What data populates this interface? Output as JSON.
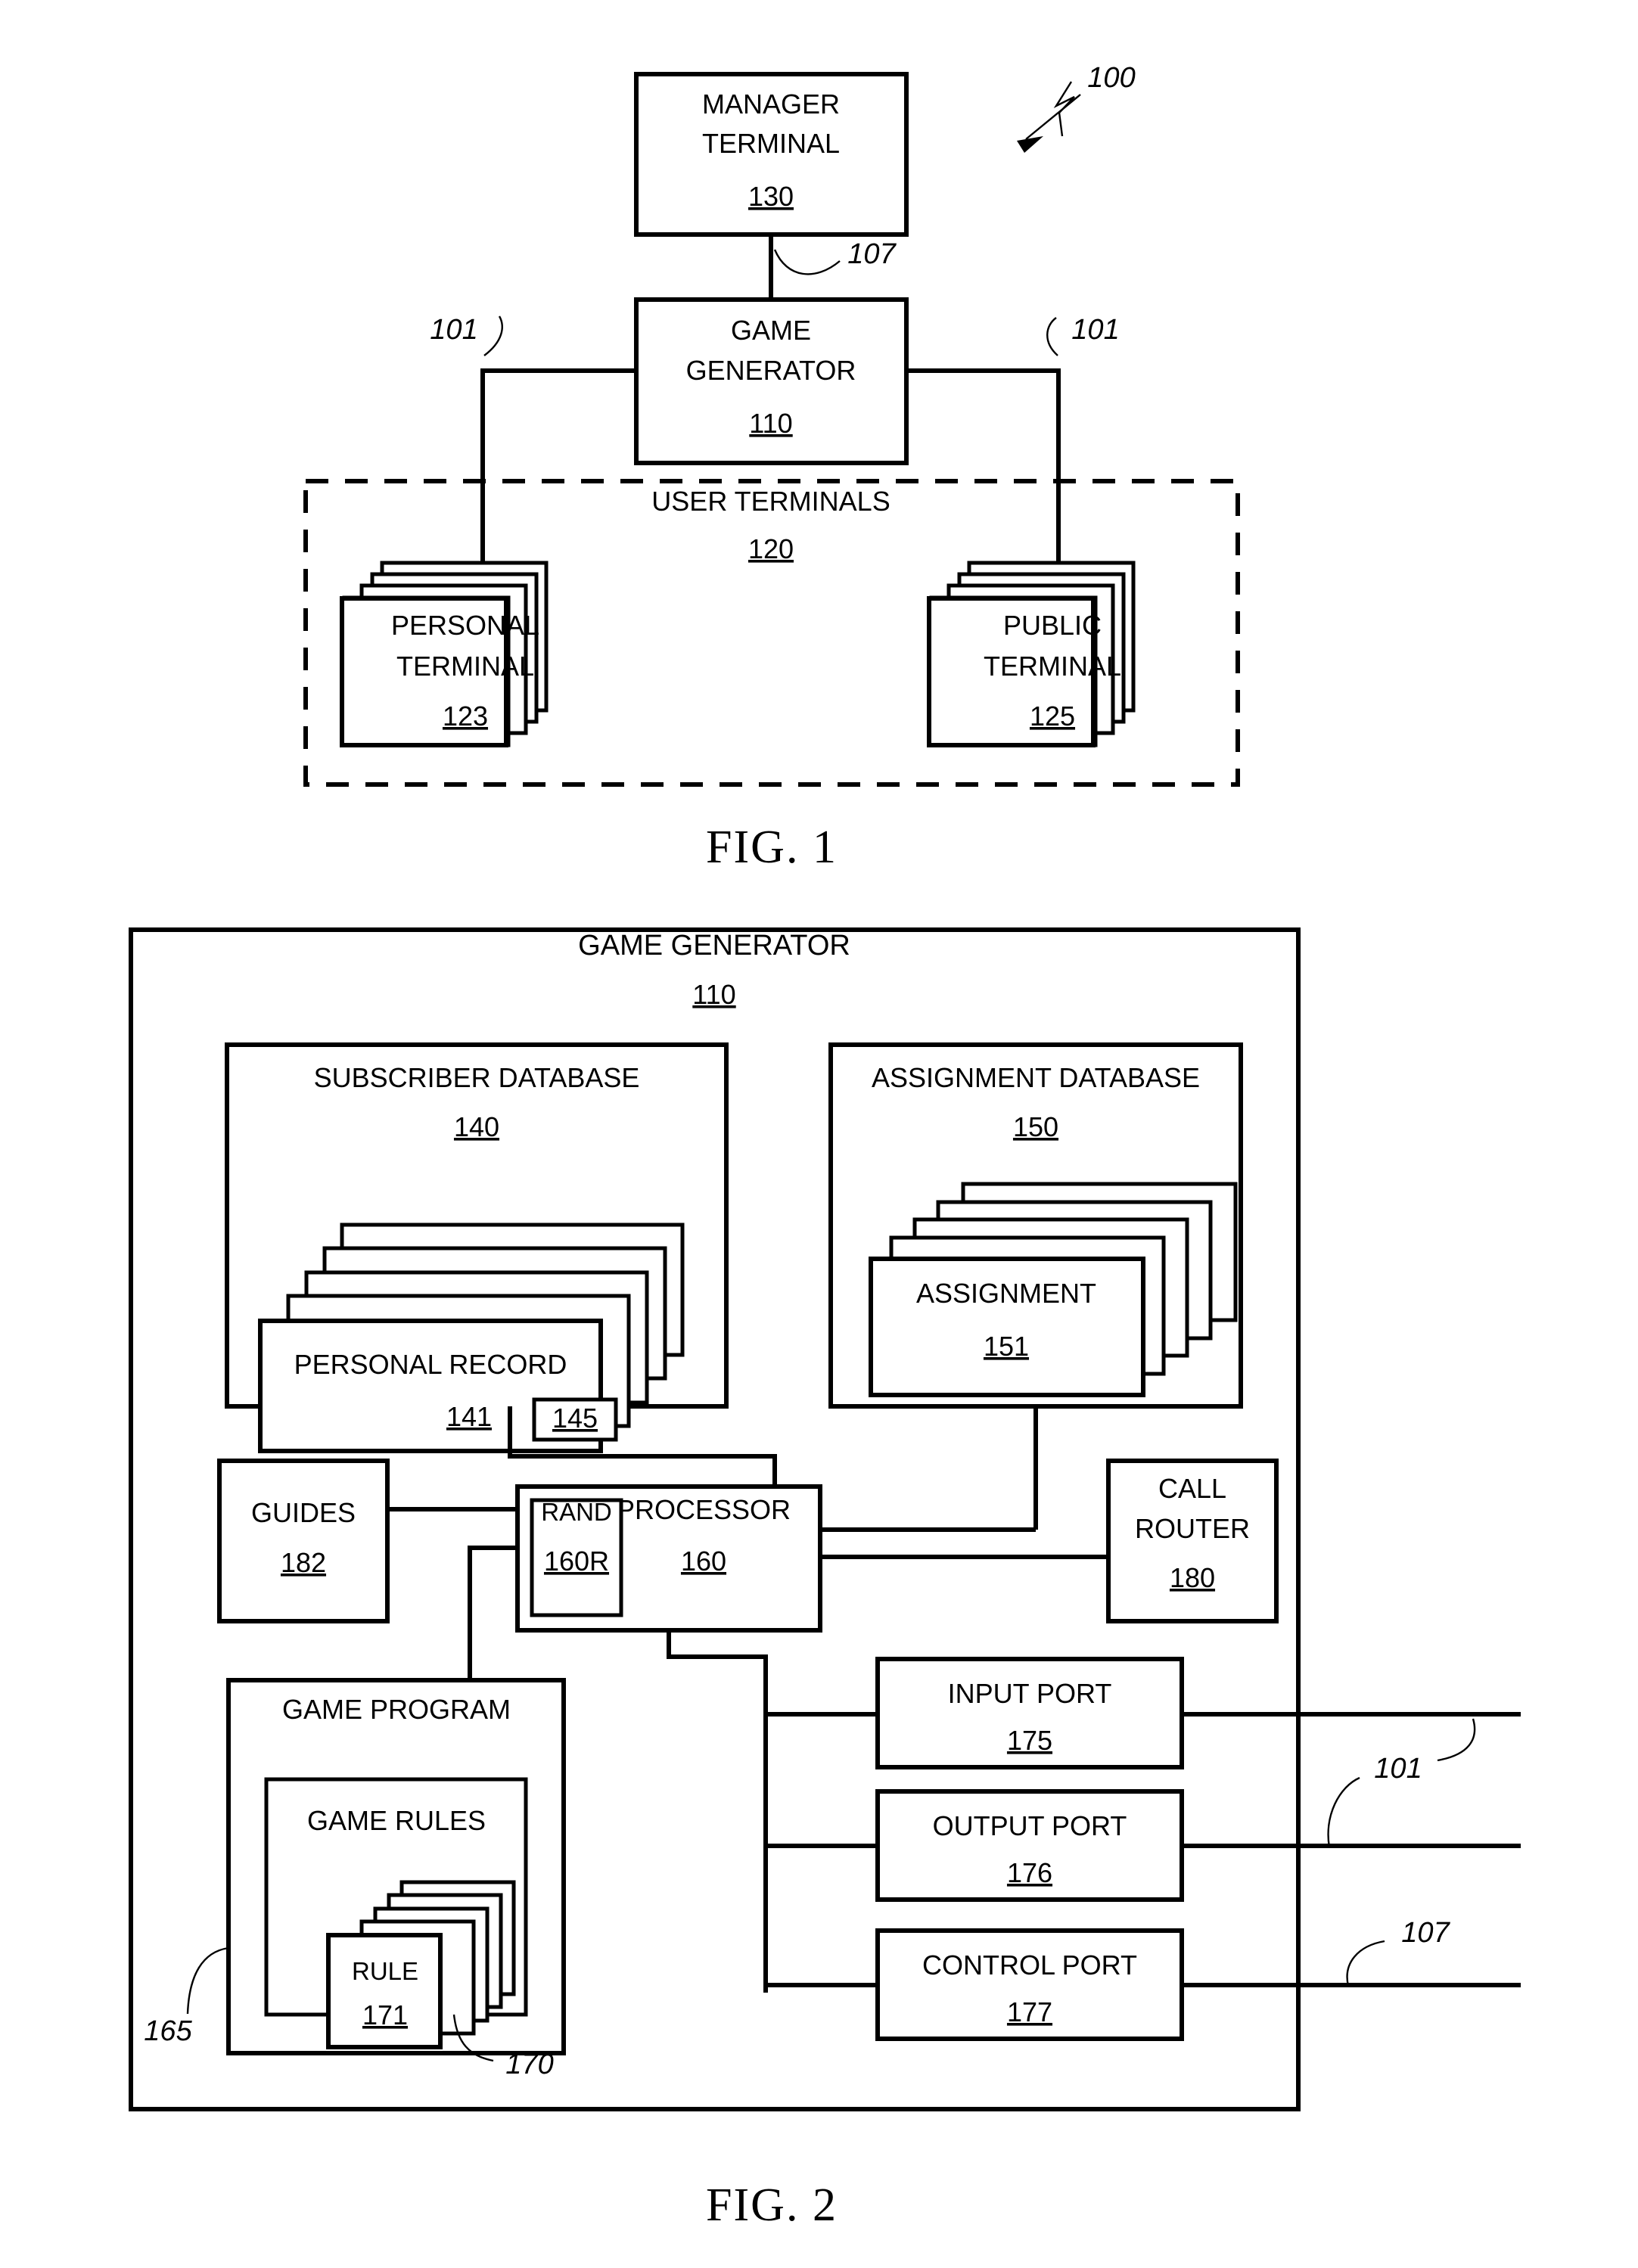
{
  "figures": [
    {
      "caption": "FIG.  1",
      "system_ref": "100",
      "blocks": {
        "manager_terminal": {
          "line1": "MANAGER",
          "line2": "TERMINAL",
          "ref": "130"
        },
        "game_generator": {
          "line1": "GAME",
          "line2": "GENERATOR",
          "ref": "110"
        },
        "user_terminals": {
          "line1": "USER TERMINALS",
          "ref": "120"
        },
        "personal_terminal": {
          "line1": "PERSONAL",
          "line2": "TERMINAL",
          "ref": "123"
        },
        "public_terminal": {
          "line1": "PUBLIC",
          "line2": "TERMINAL",
          "ref": "125"
        }
      },
      "leaders": {
        "control_link": "107",
        "data_link_left": "101",
        "data_link_right": "101"
      }
    },
    {
      "caption": "FIG.  2",
      "blocks": {
        "game_generator": {
          "line1": "GAME GENERATOR",
          "ref": "110"
        },
        "subscriber_database": {
          "line1": "SUBSCRIBER DATABASE",
          "ref": "140"
        },
        "personal_record": {
          "line1": "PERSONAL RECORD",
          "ref": "141",
          "sub_ref": "145"
        },
        "assignment_database": {
          "line1": "ASSIGNMENT DATABASE",
          "ref": "150"
        },
        "assignment": {
          "line1": "ASSIGNMENT",
          "ref": "151"
        },
        "guides": {
          "line1": "GUIDES",
          "ref": "182"
        },
        "rand": {
          "line1": "RAND",
          "ref": "160R"
        },
        "processor": {
          "line1": "PROCESSOR",
          "ref": "160"
        },
        "call_router": {
          "line1": "CALL",
          "line2": "ROUTER",
          "ref": "180"
        },
        "game_program": {
          "line1": "GAME PROGRAM"
        },
        "game_rules": {
          "line1": "GAME RULES"
        },
        "rule": {
          "line1": "RULE",
          "ref": "171"
        },
        "input_port": {
          "line1": "INPUT PORT",
          "ref": "175"
        },
        "output_port": {
          "line1": "OUTPUT PORT",
          "ref": "176"
        },
        "control_port": {
          "line1": "CONTROL PORT",
          "ref": "177"
        }
      },
      "leaders": {
        "game_program_group": "165",
        "game_rules_group": "170",
        "port_data_link": "101",
        "port_control_link": "107"
      }
    }
  ],
  "style": {
    "ink": "#000000",
    "paper": "#ffffff"
  }
}
